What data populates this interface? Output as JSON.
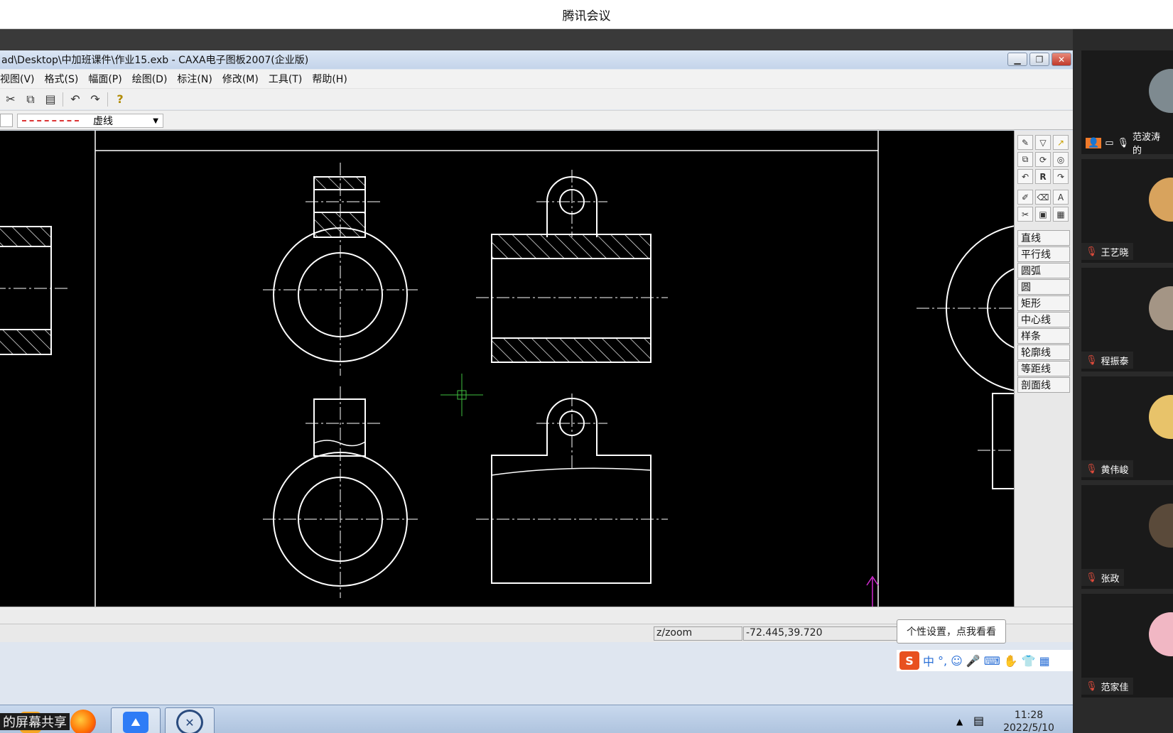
{
  "meeting": {
    "title": "腾讯会议",
    "share_label": "的屏幕共享"
  },
  "caxa": {
    "title": "ad\\Desktop\\中加班课件\\作业15.exb - CAXA电子图板2007(企业版)",
    "menus": [
      "视图(V)",
      "格式(S)",
      "幅面(P)",
      "绘图(D)",
      "标注(N)",
      "修改(M)",
      "工具(T)",
      "帮助(H)"
    ],
    "linetype": "虚线",
    "right_icons": [
      "brush-icon",
      "funnel-icon",
      "arrow-icon",
      "copy-icon",
      "refresh-icon",
      "zoom-icon",
      "undo-icon",
      "R",
      "redo-icon",
      "pen-icon",
      "eraser-icon",
      "text-icon",
      "scissors-icon",
      "block-icon",
      "table-icon"
    ],
    "commands": [
      "直线",
      "平行线",
      "圆弧",
      "圆",
      "矩形",
      "中心线",
      "样条",
      "轮廓线",
      "等距线",
      "剖面线"
    ],
    "status": {
      "command": "z/zoom",
      "coords": "-72.445,39.720"
    },
    "tooltip": "个性设置，点我看看",
    "ime": {
      "label": "中",
      "logo": "S"
    },
    "clock": {
      "time": "11:28",
      "date": "2022/5/10"
    }
  },
  "participants": [
    {
      "name": "范波涛的",
      "avatar_color": "#7e8a90",
      "self": true
    },
    {
      "name": "王艺晓",
      "avatar_color": "#d8a35d"
    },
    {
      "name": "程振泰",
      "avatar_color": "#a49585"
    },
    {
      "name": "黄伟峻",
      "avatar_color": "#e8c36a"
    },
    {
      "name": "张政",
      "avatar_color": "#5a4a3a"
    },
    {
      "name": "范家佳",
      "avatar_color": "#f1b7c4"
    }
  ]
}
